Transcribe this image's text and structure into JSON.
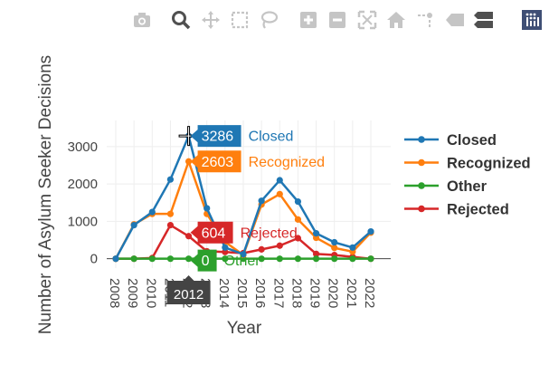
{
  "modebar": {
    "buttons": [
      {
        "icon": "camera-icon",
        "color": "#c5c5c5"
      },
      {
        "icon": "zoom-icon",
        "color": "#505050"
      },
      {
        "icon": "pan-icon",
        "color": "#c5c5c5"
      },
      {
        "icon": "box-select-icon",
        "color": "#c5c5c5"
      },
      {
        "icon": "lasso-icon",
        "color": "#c5c5c5"
      },
      {
        "icon": "zoom-in-icon",
        "color": "#c5c5c5"
      },
      {
        "icon": "zoom-out-icon",
        "color": "#c5c5c5"
      },
      {
        "icon": "autoscale-icon",
        "color": "#c5c5c5"
      },
      {
        "icon": "reset-axes-icon",
        "color": "#c5c5c5"
      },
      {
        "icon": "spike-lines-icon",
        "color": "#c5c5c5"
      },
      {
        "icon": "hover-closest-icon",
        "color": "#c5c5c5"
      },
      {
        "icon": "hover-compare-icon",
        "color": "#505050"
      },
      {
        "icon": "plotly-logo-icon",
        "color": "#3f4f75"
      }
    ]
  },
  "chart_data": {
    "type": "line",
    "xlabel": "Year",
    "ylabel": "Number of Asylum Seeker Decisions",
    "x": [
      2008,
      2009,
      2010,
      2011,
      2012,
      2013,
      2014,
      2015,
      2016,
      2017,
      2018,
      2019,
      2020,
      2021,
      2022
    ],
    "xticks": [
      "2008",
      "2009",
      "2010",
      "2011",
      "2012",
      "2013",
      "2014",
      "2015",
      "2016",
      "2017",
      "2018",
      "2019",
      "2020",
      "2021",
      "2022"
    ],
    "yticks": [
      0,
      1000,
      2000,
      3000
    ],
    "ylim": [
      -250,
      3700
    ],
    "grid": true,
    "legend_position": "right",
    "series": [
      {
        "name": "Closed",
        "color": "#1f77b4",
        "values": [
          0,
          900,
          1250,
          2120,
          3286,
          1350,
          300,
          120,
          1550,
          2100,
          1530,
          680,
          440,
          300,
          730
        ]
      },
      {
        "name": "Recognized",
        "color": "#ff7f0e",
        "values": [
          0,
          920,
          1200,
          1200,
          2603,
          1200,
          450,
          100,
          1450,
          1730,
          1050,
          560,
          290,
          190,
          700
        ]
      },
      {
        "name": "Other",
        "color": "#2ca02c",
        "values": [
          0,
          0,
          0,
          0,
          0,
          0,
          0,
          0,
          0,
          0,
          0,
          0,
          0,
          0,
          0
        ]
      },
      {
        "name": "Rejected",
        "color": "#d62728",
        "values": [
          0,
          0,
          20,
          900,
          604,
          200,
          180,
          150,
          250,
          350,
          550,
          130,
          100,
          50,
          0
        ]
      }
    ],
    "hover": {
      "x_label": "2012",
      "labels": [
        {
          "value": "3286",
          "name": "Closed",
          "series": 0,
          "text_color": "#1f77b4",
          "value_y": 3286
        },
        {
          "value": "2603",
          "name": "Recognized",
          "series": 1,
          "text_color": "#ff7f0e",
          "value_y": 2603
        },
        {
          "value": "604",
          "name": "Rejected",
          "series": 3,
          "text_color": "#d62728",
          "value_y": 604
        },
        {
          "value": "0",
          "name": "Other",
          "series": 2,
          "text_color": "#2ca02c",
          "value_y": 0
        }
      ]
    }
  }
}
